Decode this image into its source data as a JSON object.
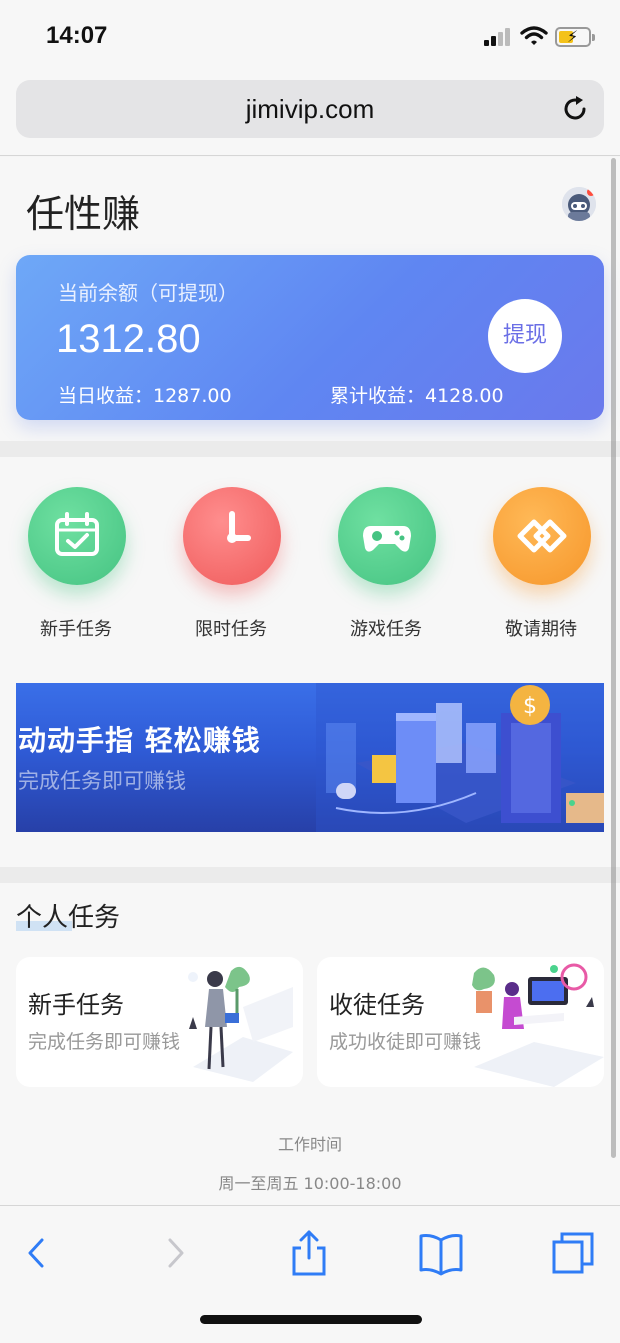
{
  "status": {
    "time": "14:07"
  },
  "browser": {
    "url": "jimivip.com"
  },
  "header": {
    "title": "任性赚"
  },
  "balance": {
    "label": "当前余额（可提现）",
    "value": "1312.80",
    "withdraw_label": "提现",
    "today_label": "当日收益：1287.00",
    "total_label": "累计收益：4128.00"
  },
  "tasks": [
    {
      "label": "新手任务",
      "icon": "calendar-check-icon"
    },
    {
      "label": "限时任务",
      "icon": "clock-icon"
    },
    {
      "label": "游戏任务",
      "icon": "gamepad-icon"
    },
    {
      "label": "敬请期待",
      "icon": "diamond-link-icon"
    }
  ],
  "banner": {
    "title": "动动手指 轻松赚钱",
    "subtitle": "完成任务即可赚钱"
  },
  "personal": {
    "title": "个人任务",
    "cards": [
      {
        "title": "新手任务",
        "subtitle": "完成任务即可赚钱"
      },
      {
        "title": "收徒任务",
        "subtitle": "成功收徒即可赚钱"
      }
    ]
  },
  "footer": {
    "work_title": "工作时间",
    "work_hours": "周一至周五 10:00-18:00"
  },
  "colors": {
    "accent": "#6b6fe6",
    "card_gradient_start": "#6ea8f7",
    "card_gradient_end": "#6a79ec",
    "ios_blue": "#2f7cf6"
  }
}
